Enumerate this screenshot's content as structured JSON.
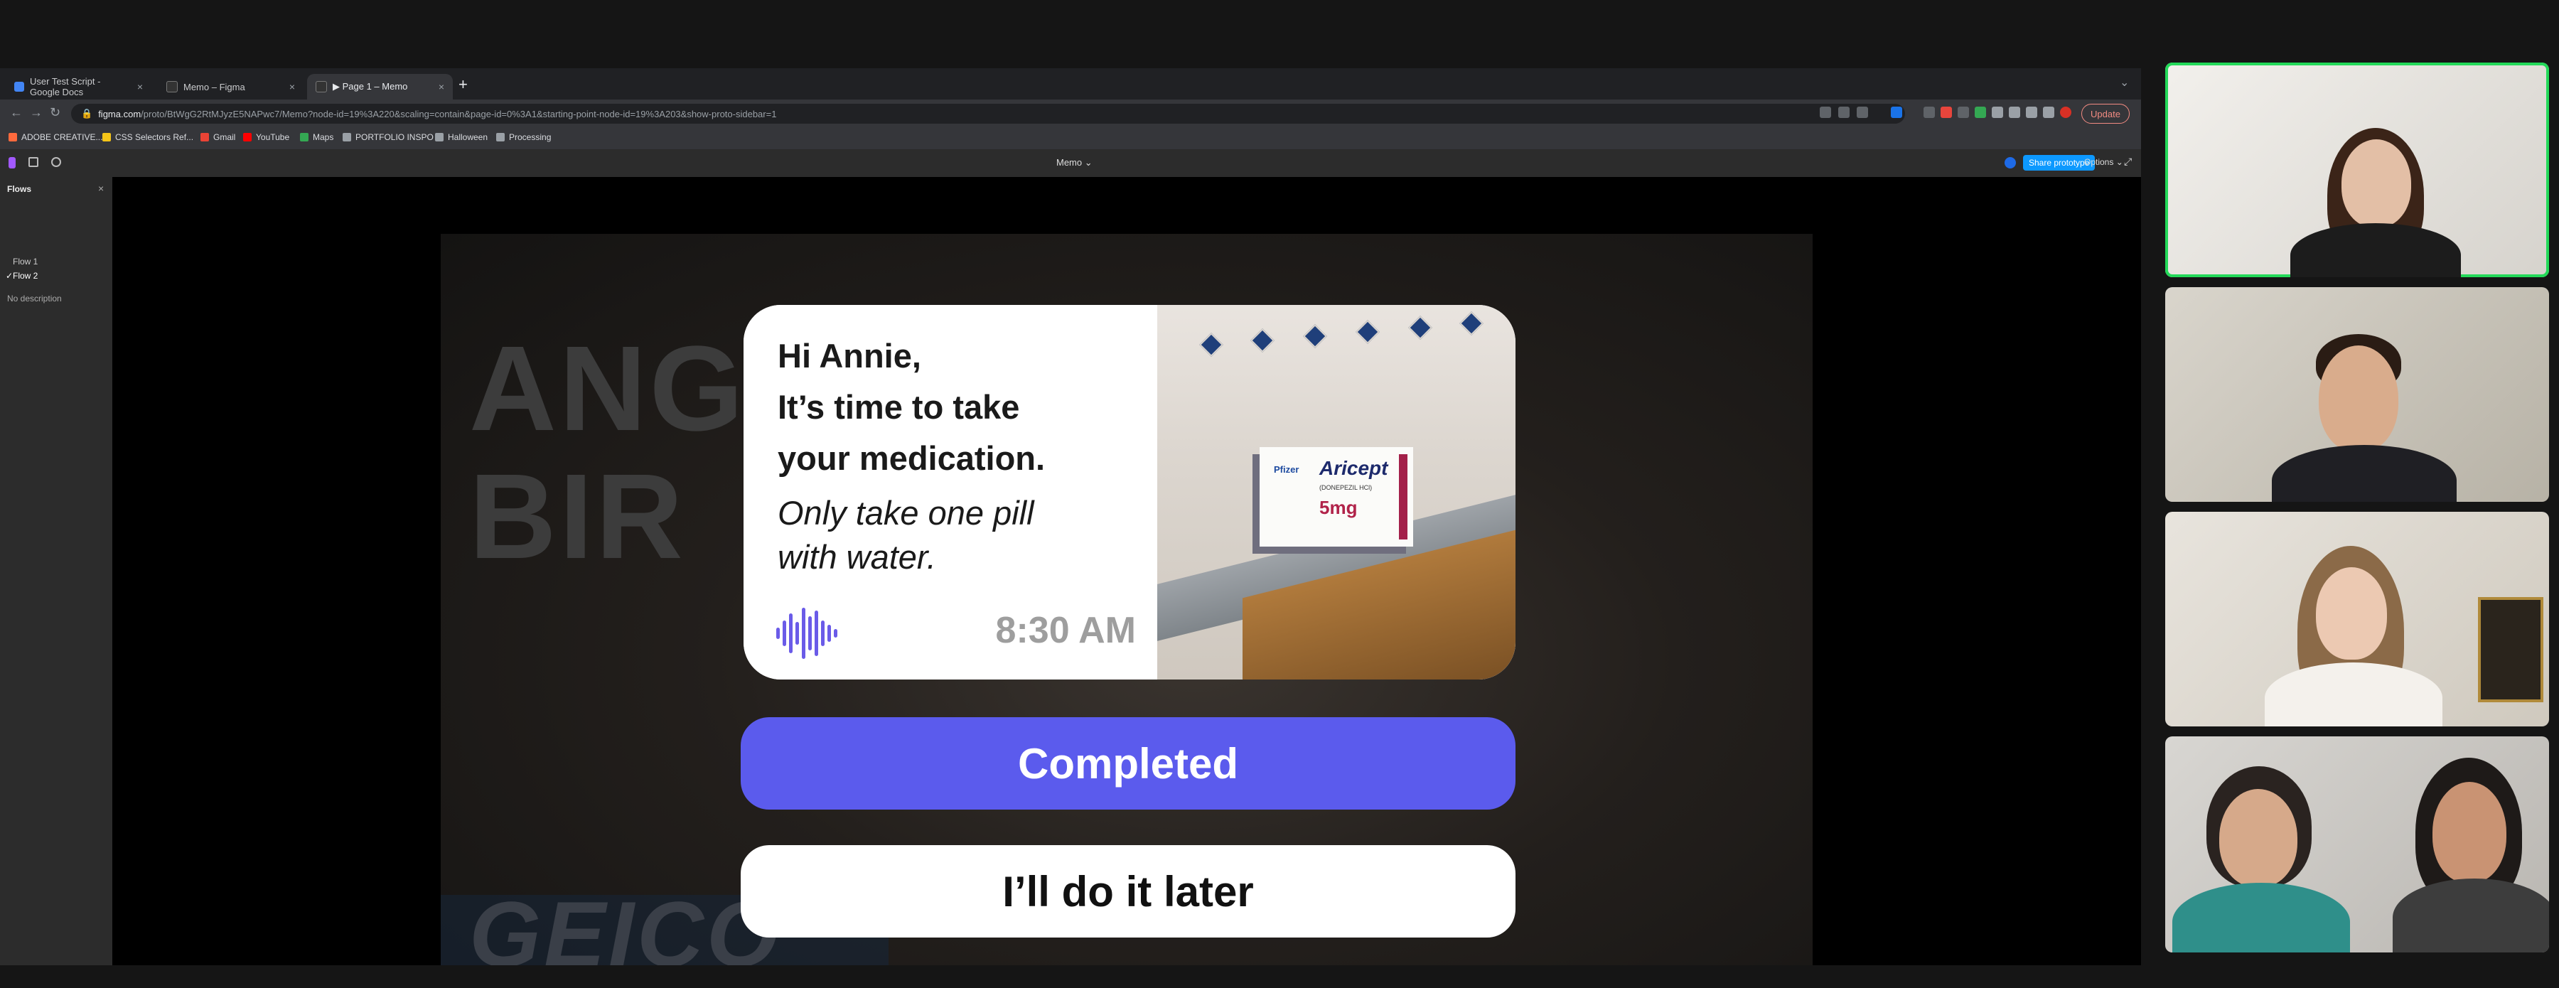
{
  "browser": {
    "tabs": [
      {
        "label": "User Test Script - Google Docs",
        "favicon_color": "#4285f4",
        "active": false
      },
      {
        "label": "Memo – Figma",
        "favicon_color": "#333333",
        "active": false
      },
      {
        "label": "▶ Page 1 – Memo",
        "favicon_color": "#333333",
        "active": true
      }
    ],
    "new_tab": "+",
    "tab_menu": "⌄",
    "url_host": "figma.com",
    "url_rest": "/proto/BtWgG2RtMJyzE5NAPwc7/Memo?node-id=19%3A220&scaling=contain&page-id=0%3A1&starting-point-node-id=19%3A203&show-proto-sidebar=1",
    "update_label": "Update",
    "bookmarks": [
      {
        "label": "ADOBE CREATIVE...",
        "icon_color": "#ff6a3d"
      },
      {
        "label": "CSS Selectors Ref...",
        "icon_color": "#f5c518"
      },
      {
        "label": "Gmail",
        "icon_color": "#ea4335"
      },
      {
        "label": "YouTube",
        "icon_color": "#ff0000"
      },
      {
        "label": "Maps",
        "icon_color": "#34a853"
      },
      {
        "label": "PORTFOLIO INSPO",
        "icon_color": "#9aa0a6"
      },
      {
        "label": "Halloween",
        "icon_color": "#9aa0a6"
      },
      {
        "label": "Processing",
        "icon_color": "#9aa0a6"
      }
    ]
  },
  "figma": {
    "file_title": "Memo ⌄",
    "share_label": "Share prototype",
    "options_label": "Options ⌄",
    "sidebar": {
      "heading": "Flows",
      "flows": [
        "Flow 1",
        "Flow 2"
      ],
      "active_flow": "Flow 2",
      "description": "No description"
    }
  },
  "frame": {
    "background_words": [
      "ANG",
      "BIR",
      "GEICO"
    ],
    "card": {
      "greeting_lines": [
        "Hi Annie,",
        "It’s time to take",
        "your medication."
      ],
      "instruction_lines": [
        "Only take one pill",
        "with water."
      ],
      "time": "8:30 AM",
      "box_brand": "Aricept",
      "box_sub": "(DONEPEZIL HCl)",
      "box_dose": "5mg",
      "box_maker": "Pfizer"
    },
    "primary_button": "Completed",
    "secondary_button": "I’ll do it later",
    "colors": {
      "primary": "#5b5bed",
      "waveform": "#6a5be8",
      "time": "#9e9e9e"
    }
  },
  "zoom": {
    "participants": [
      {
        "tile": "participant-1",
        "speaking": true
      },
      {
        "tile": "participant-2",
        "speaking": false
      },
      {
        "tile": "participant-3",
        "speaking": false
      },
      {
        "tile": "participant-4",
        "speaking": false
      }
    ],
    "speaking_color": "#23d959"
  }
}
